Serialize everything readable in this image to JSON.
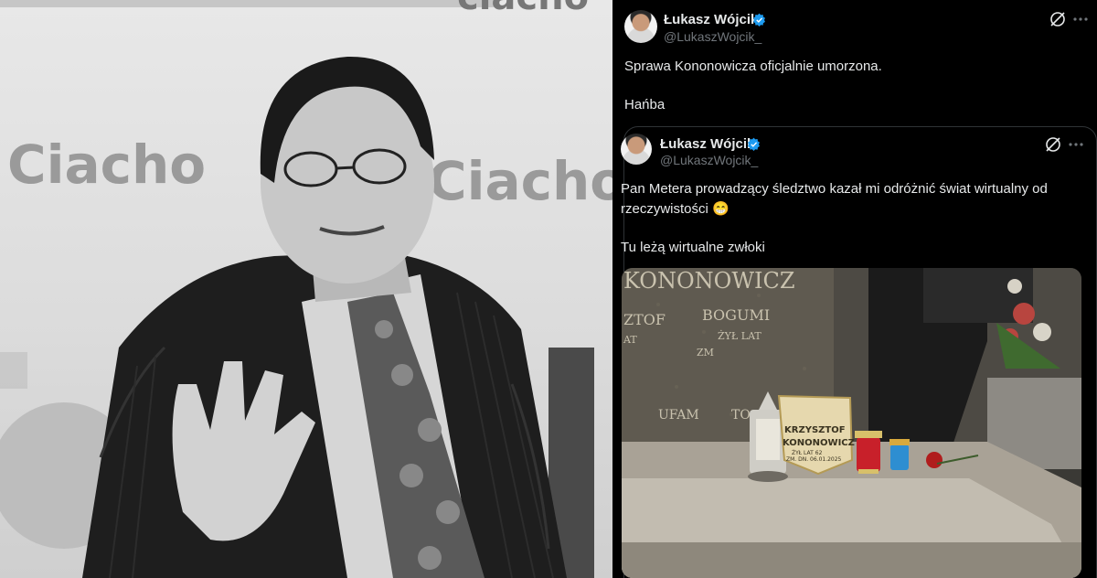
{
  "photo": {
    "backdrop_logo_text": "Ciacho",
    "backdrop_logo_text_2": "Ciacho"
  },
  "tweet": {
    "author_name": "Łukasz Wójcik",
    "author_handle": "@LukaszWojcik_",
    "text_line_1": "Sprawa Kononowicza oficjalnie umorzona.",
    "text_line_2": "Hańba",
    "verified_color": "#1d9bf0"
  },
  "quoted_tweet": {
    "author_name": "Łukasz Wójcik",
    "author_handle": "@LukaszWojcik_",
    "text_line_1": "Pan Metera prowadzący śledztwo kazał mi odróżnić świat wirtualny od",
    "text_line_2": "rzeczywistości 😁",
    "text_line_3": "Tu leżą wirtualne zwłoki"
  },
  "grave_photo": {
    "inscription_surname": "KONONOWICZ",
    "inscription_first": "ZTOF",
    "inscription_second": "BOGUMI",
    "inscription_third": "ŻYŁ LAT",
    "inscription_fourth": "ZM",
    "inscription_fifth": "AT",
    "inscription_motto_1": "UFAM",
    "inscription_motto_2": "TO",
    "plaque_line_1": "KRZYSZTOF",
    "plaque_line_2": "KONONOWICZ",
    "plaque_line_3": "ŻYŁ LAT 62",
    "plaque_line_4": "ZM. DN. 06.01.2025"
  }
}
